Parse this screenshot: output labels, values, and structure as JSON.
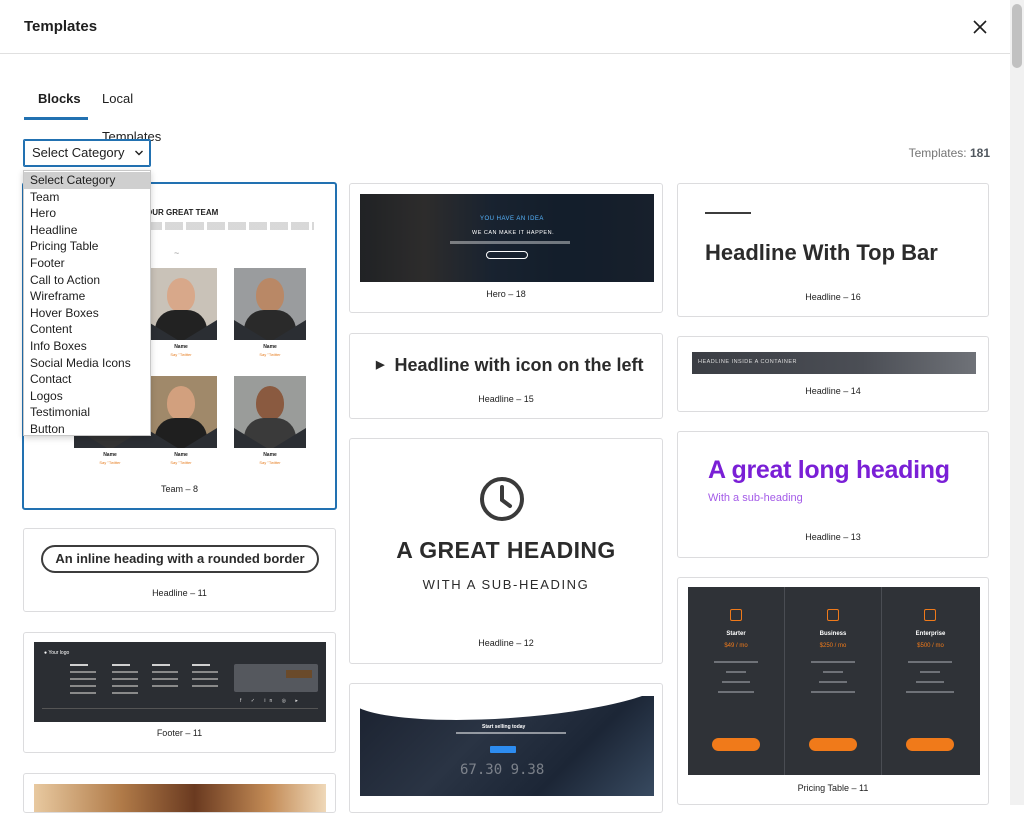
{
  "header": {
    "title": "Templates"
  },
  "tabs": [
    {
      "label": "Blocks",
      "active": true
    },
    {
      "label": "Local Templates",
      "active": false
    }
  ],
  "category_select": {
    "value": "Select Category",
    "options": [
      "Select Category",
      "Team",
      "Hero",
      "Headline",
      "Pricing Table",
      "Footer",
      "Call to Action",
      "Wireframe",
      "Hover Boxes",
      "Content",
      "Info Boxes",
      "Social Media Icons",
      "Contact",
      "Logos",
      "Testimonial",
      "Button"
    ]
  },
  "count": {
    "label": "Templates:",
    "value": "181"
  },
  "colors": {
    "accent": "#2271b1",
    "orange": "#f07a1a",
    "purple": "#7a1fd6"
  },
  "cards": {
    "team8": {
      "caption": "Team – 8",
      "heading": "OUR GREAT TEAM",
      "members": [
        {
          "name": "Name",
          "link": "Say \"Twitter"
        },
        {
          "name": "Name",
          "link": "Say \"Twitter"
        },
        {
          "name": "Name",
          "link": "Say \"Twitter"
        },
        {
          "name": "Name",
          "link": "Say \"Twitter"
        },
        {
          "name": "Name",
          "link": "Say \"Twitter"
        },
        {
          "name": "Name",
          "link": "Say \"Twitter"
        }
      ]
    },
    "headline11": {
      "caption": "Headline – 11",
      "text": "An inline heading with a rounded border"
    },
    "footer11": {
      "caption": "Footer – 11",
      "logo": "Your logo",
      "social": "f ✓ in ◎ ▸"
    },
    "hero18": {
      "caption": "Hero – 18",
      "line1a": "YOU HAVE AN",
      "line1b": "IDEA",
      "line2": "WE CAN MAKE IT HAPPEN."
    },
    "headline15": {
      "caption": "Headline – 15",
      "text": "Headline with icon on the left"
    },
    "headline12": {
      "caption": "Headline – 12",
      "heading": "A GREAT HEADING",
      "sub": "WITH A SUB-HEADING"
    },
    "cta": {
      "title": "Start selling today",
      "nums": "67.30 9.38"
    },
    "headline16": {
      "caption": "Headline – 16",
      "text": "Headline With Top Bar"
    },
    "headline14": {
      "caption": "Headline – 14",
      "text": "HEADLINE INSIDE A CONTAINER"
    },
    "headline13": {
      "caption": "Headline – 13",
      "heading": "A great long heading",
      "sub": "With a sub-heading"
    },
    "pricing11": {
      "caption": "Pricing Table – 11",
      "plans": [
        {
          "name": "Starter",
          "price": "$49 / mo"
        },
        {
          "name": "Business",
          "price": "$250 / mo"
        },
        {
          "name": "Enterprise",
          "price": "$500 / mo"
        }
      ]
    }
  }
}
